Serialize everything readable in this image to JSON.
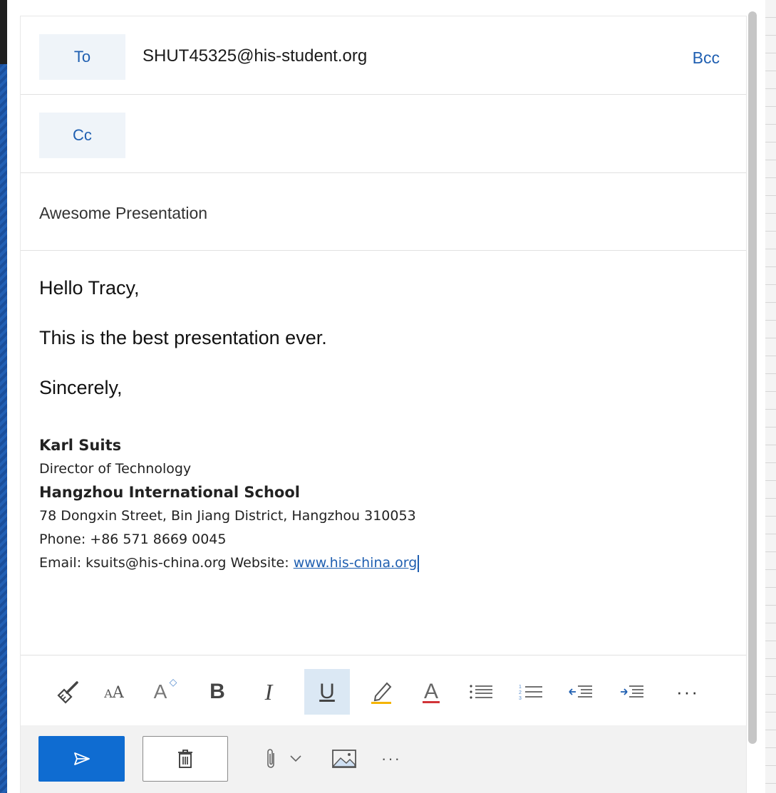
{
  "recipients": {
    "to_label": "To",
    "to_value": "SHUT45325@his-student.org",
    "bcc_label": "Bcc",
    "cc_label": "Cc"
  },
  "subject": "Awesome Presentation",
  "message": {
    "greeting": "Hello Tracy,",
    "body": "This is the best presentation ever.",
    "closing": "Sincerely,"
  },
  "signature": {
    "name": "Karl Suits",
    "title": "Director of Technology",
    "organization": "Hangzhou International School",
    "address": "78 Dongxin Street, Bin Jiang District, Hangzhou 310053",
    "phone": "Phone: +86 571 8669 0045",
    "email_line": "Email: ksuits@his-china.org Website: ",
    "website": "www.his-china.org"
  },
  "format_toolbar": {
    "items": [
      {
        "name": "format-painter-icon"
      },
      {
        "name": "font-size-icon"
      },
      {
        "name": "grow-font-icon"
      },
      {
        "name": "bold-icon",
        "label": "B"
      },
      {
        "name": "italic-icon",
        "label": "I"
      },
      {
        "name": "underline-icon",
        "label": "U",
        "active": true
      },
      {
        "name": "highlight-icon",
        "color": "#f4b400"
      },
      {
        "name": "font-color-icon",
        "color": "#d13438"
      },
      {
        "name": "bullets-icon"
      },
      {
        "name": "numbering-icon"
      },
      {
        "name": "decrease-indent-icon"
      },
      {
        "name": "increase-indent-icon"
      },
      {
        "name": "more-icon",
        "label": "···"
      }
    ]
  },
  "actions": {
    "send": "send-icon",
    "discard": "trash-icon",
    "attach": "paperclip-icon",
    "attach_dropdown": "chevron-down-icon",
    "insert_picture": "picture-icon",
    "more": "···"
  },
  "colors": {
    "accent": "#0f6cd1",
    "link": "#1f5fb1",
    "pill_bg": "#eff4f9",
    "active_tool_bg": "#dbe8f4"
  }
}
